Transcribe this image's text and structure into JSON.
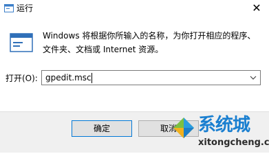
{
  "window": {
    "title": "运行",
    "icon": "run-icon",
    "close_icon": "close-icon"
  },
  "description": {
    "icon": "run-large-icon",
    "text": "Windows 将根据你所输入的名称，为你打开相应的程序、文件夹、文档或 Internet 资源。"
  },
  "open_field": {
    "label": "打开(O):",
    "value": "gpedit.msc",
    "dropdown_icon": "chevron-down-icon"
  },
  "buttons": {
    "ok": "确定",
    "cancel": "取消"
  },
  "watermark": {
    "brand": "系统城",
    "url": "xitongcheng.com"
  }
}
